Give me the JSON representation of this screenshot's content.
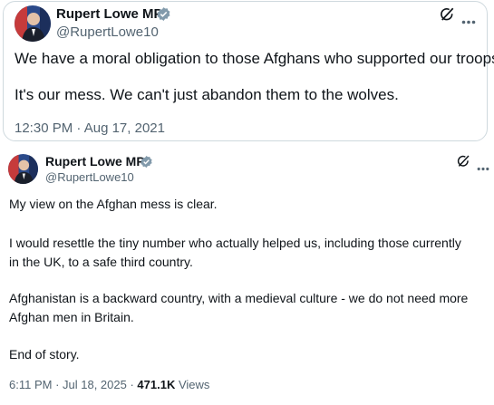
{
  "quoted_tweet": {
    "author_name": "Rupert Lowe MP",
    "author_handle": "@RupertLowe10",
    "lines": [
      "We have a moral obligation to those Afghans who supported our troops.",
      "It's our mess. We can't just abandon them to the wolves."
    ],
    "time": "12:30 PM",
    "date": "Aug 17, 2021"
  },
  "main_tweet": {
    "author_name": "Rupert Lowe MP",
    "author_handle": "@RupertLowe10",
    "lines": [
      "My view on the Afghan mess is clear.",
      "I would resettle the tiny number who actually helped us, including those currently",
      "in the UK, to a safe third country.",
      "Afghanistan is a backward country, with a medieval culture - we do not need more",
      "Afghan men in Britain.",
      "End of story."
    ],
    "time": "6:11 PM",
    "date": "Jul 18, 2025",
    "views_count": "471.1K",
    "views_label": "Views"
  },
  "icons": {
    "verified": "verified-badge-icon",
    "grok": "grok-icon",
    "more": "more-icon"
  },
  "colors": {
    "text": "#0f1419",
    "secondary": "#536471",
    "border": "#cfd9de",
    "verified": "#829aab"
  }
}
